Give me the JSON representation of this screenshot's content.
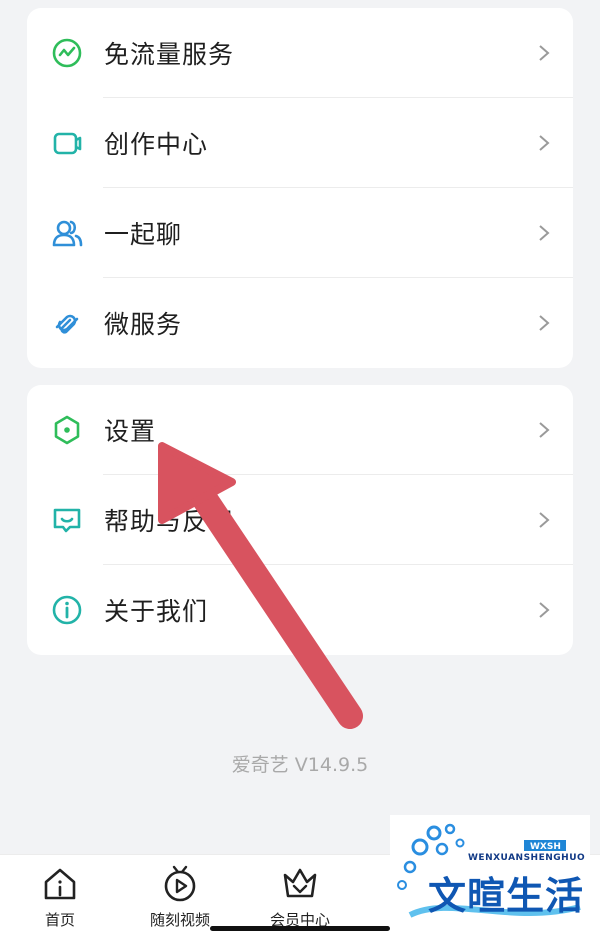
{
  "menu_group_1": [
    {
      "label": "免流量服务",
      "icon": "flow-icon"
    },
    {
      "label": "创作中心",
      "icon": "camera-icon"
    },
    {
      "label": "一起聊",
      "icon": "users-icon"
    },
    {
      "label": "微服务",
      "icon": "link-icon"
    }
  ],
  "menu_group_2": [
    {
      "label": "设置",
      "icon": "hexagon-settings-icon"
    },
    {
      "label": "帮助与反馈",
      "icon": "feedback-icon"
    },
    {
      "label": "关于我们",
      "icon": "info-icon"
    }
  ],
  "version": "爱奇艺 V14.9.5",
  "tabbar": [
    {
      "label": "首页",
      "icon": "home-icon"
    },
    {
      "label": "随刻视频",
      "icon": "play-icon"
    },
    {
      "label": "会员中心",
      "icon": "vip-icon"
    }
  ],
  "watermark": {
    "text_cn": "文暄生活",
    "text_en": "WENXUANSHENGHUO",
    "text_abbr": "WXSH"
  },
  "colors": {
    "accent_green": "#2fbd5a",
    "teal": "#22b3a8",
    "arrow_red": "#d8535f"
  }
}
